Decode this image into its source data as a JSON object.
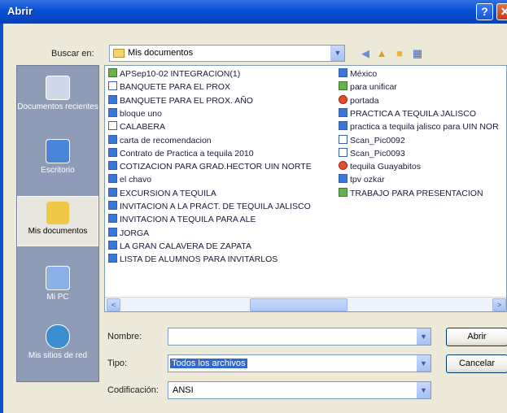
{
  "title": "Abrir",
  "help_glyph": "?",
  "close_glyph": "✕",
  "look_in_label": "Buscar en:",
  "look_in_value": "Mis documentos",
  "places": [
    {
      "label": "Documentos recientes"
    },
    {
      "label": "Escritorio"
    },
    {
      "label": "Mis documentos"
    },
    {
      "label": "Mi PC"
    },
    {
      "label": "Mis sitios de red"
    }
  ],
  "files_col1": [
    "APSep10-02 INTEGRACION(1)",
    "BANQUETE PARA EL PROX",
    "BANQUETE PARA EL PROX. AÑO",
    "bloque uno",
    "CALABERA",
    "carta de recomendacion",
    "Contrato de Practica  a tequila 2010",
    "COTIZACION PARA GRAD.HECTOR UIN NORTE",
    "el chavo",
    "EXCURSION A TEQUILA",
    "INVITACION A LA PRACT. DE TEQUILA JALISCO",
    "INVITACION A TEQUILA PARA ALE",
    "JORGA",
    "LA GRAN CALAVERA DE ZAPATA",
    "LISTA DE ALUMNOS PARA INVITARLOS"
  ],
  "files_col2": [
    "México",
    "para unificar",
    "portada",
    "PRACTICA A TEQUILA JALISCO",
    "practica a tequila jalisco para UIN NOR",
    "Scan_Pic0092",
    "Scan_Pic0093",
    "tequila Guayabitos",
    "tpv ozkar",
    "TRABAJO PARA PRESENTACION"
  ],
  "filename_label": "Nombre:",
  "filename_value": "",
  "type_label": "Tipo:",
  "type_value": "Todos los archivos",
  "encoding_label": "Codificación:",
  "encoding_value": "ANSI",
  "open_button": "Abrir",
  "cancel_button": "Cancelar",
  "scroll_left": "<",
  "scroll_right": ">",
  "dropdown_glyph": "▼"
}
